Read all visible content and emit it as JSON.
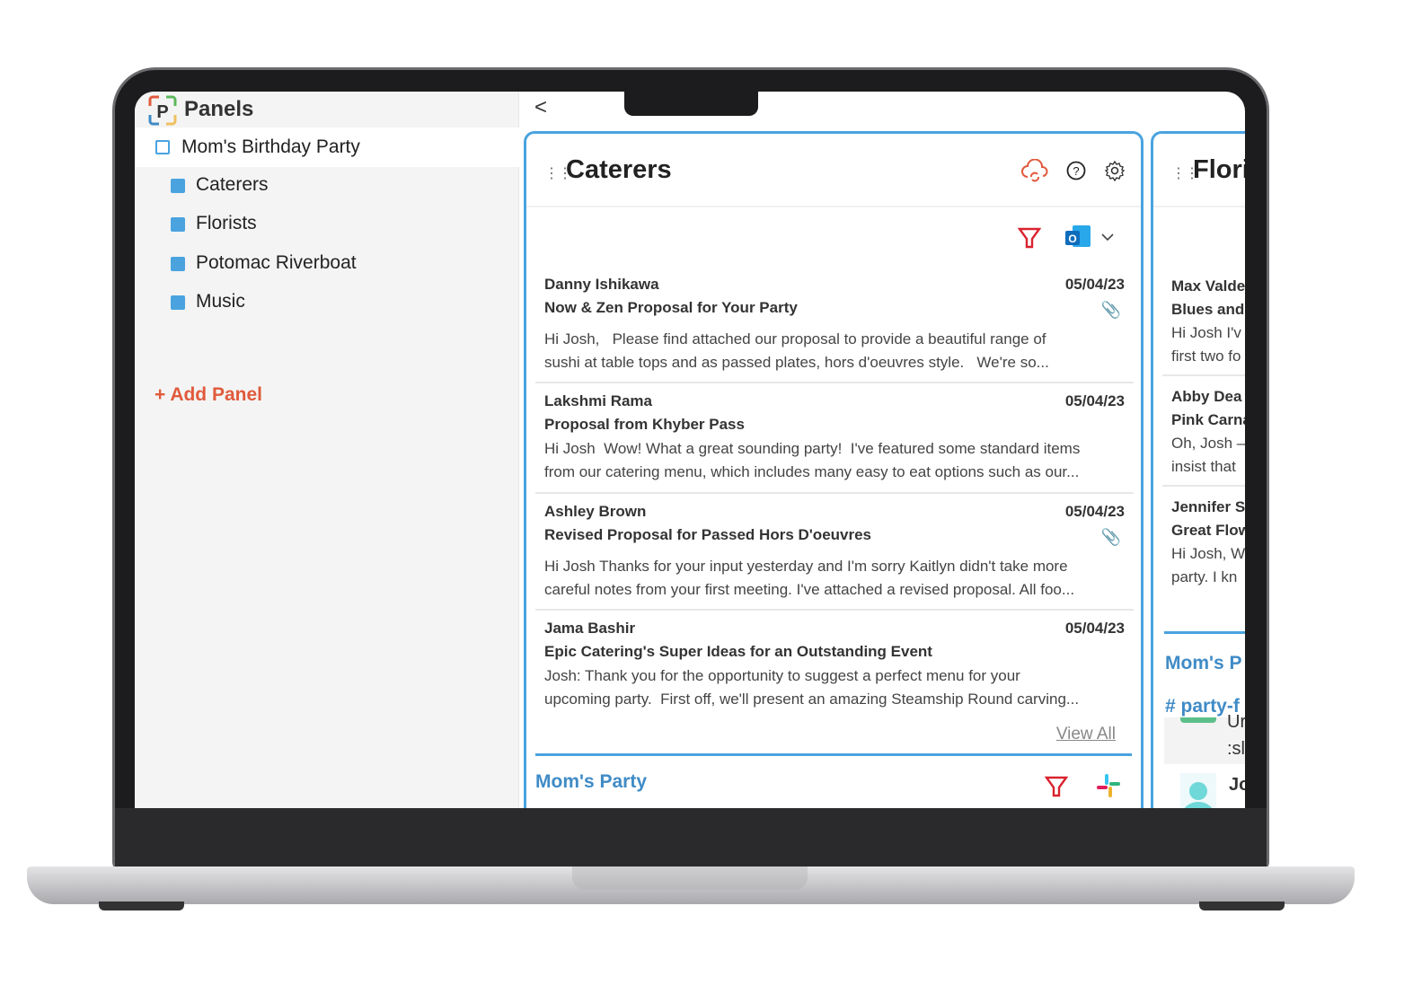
{
  "sidebar": {
    "brand": "Panels",
    "logo_letter": "P",
    "project": "Mom's Birthday Party",
    "items": [
      {
        "label": "Caterers"
      },
      {
        "label": "Florists"
      },
      {
        "label": "Potomac Riverboat"
      },
      {
        "label": "Music"
      }
    ],
    "add_panel": "+ Add Panel"
  },
  "nav": {
    "back": "<"
  },
  "colors": {
    "accent": "#4aa3df",
    "add": "#e05a3c",
    "filter": "#d9232e",
    "section": "#3f8bc6"
  },
  "caterers": {
    "title": "Caterers",
    "icons": [
      "cloud-sync-icon",
      "help-icon",
      "gear-icon",
      "filter-icon",
      "outlook-icon",
      "chevron-down-icon"
    ],
    "emails": [
      {
        "from": "Danny Ishikawa",
        "date": "05/04/23",
        "subject": "Now & Zen Proposal for Your Party",
        "attachment": true,
        "body": "Hi Josh,   Please find attached our proposal to provide a beautiful range of\nsushi at table tops and as passed plates, hors d'oeuvres style.   We're so..."
      },
      {
        "from": "Lakshmi Rama",
        "date": "05/04/23",
        "subject": "Proposal from Khyber Pass",
        "attachment": false,
        "body": "Hi Josh  Wow! What a great sounding party!  I've featured some standard items\nfrom our catering menu, which includes many easy to eat options such as our..."
      },
      {
        "from": "Ashley Brown",
        "date": "05/04/23",
        "subject": "Revised Proposal for Passed Hors D'oeuvres",
        "attachment": true,
        "body": "Hi Josh Thanks for your input yesterday and I'm sorry Kaitlyn didn't take more\ncareful notes from your first meeting. I've attached a revised proposal. All foo..."
      },
      {
        "from": "Jama Bashir",
        "date": "05/04/23",
        "subject": "Epic Catering's Super Ideas for an Outstanding Event",
        "attachment": false,
        "body": "Josh: Thank you for the opportunity to suggest a perfect menu for your\nupcoming party.  First off, we'll present an amazing Steamship Round carving..."
      }
    ],
    "view_all": "View All",
    "section": "Mom's Party"
  },
  "florists": {
    "title": "Flori",
    "emails": [
      {
        "from": "Max Valde",
        "subject": "Blues and",
        "l1": "Hi Josh  I'v",
        "l2": "first two fo"
      },
      {
        "from": "Abby Dea",
        "subject": "Pink Carna",
        "l1": "Oh, Josh –",
        "l2": "insist that"
      },
      {
        "from": "Jennifer S",
        "subject": "Great Flow",
        "l1": "Hi Josh,  W",
        "l2": "party.  I kn"
      }
    ],
    "section": "Mom's P",
    "channel": "# party-f",
    "msg1a": "Ur",
    "msg1b": ":sl",
    "msg2": "Jo"
  }
}
